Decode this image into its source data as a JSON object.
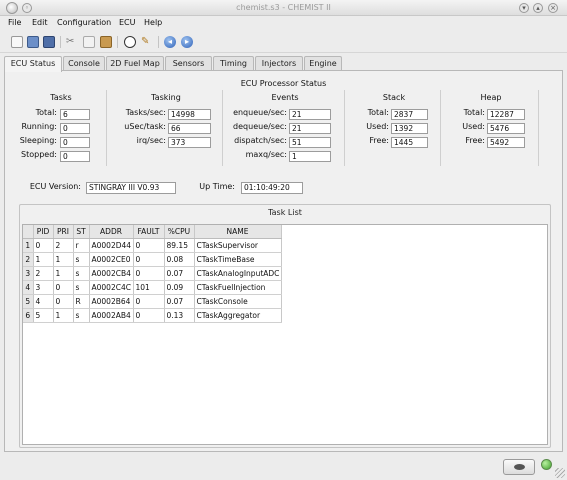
{
  "window": {
    "title": "chemist.s3 - CHEMIST II"
  },
  "menu": [
    "File",
    "Edit",
    "Configuration",
    "ECU",
    "Help"
  ],
  "tabs": [
    "ECU Status",
    "Console",
    "2D Fuel Map",
    "Sensors",
    "Timing",
    "Injectors",
    "Engine"
  ],
  "status": {
    "title": "ECU Processor Status",
    "tasks": {
      "heading": "Tasks",
      "total_label": "Total:",
      "total": "6",
      "running_label": "Running:",
      "running": "0",
      "sleeping_label": "Sleeping:",
      "sleeping": "0",
      "stopped_label": "Stopped:",
      "stopped": "0"
    },
    "tasking": {
      "heading": "Tasking",
      "tps_label": "Tasks/sec:",
      "tps": "14998",
      "ups_label": "uSec/task:",
      "ups": "66",
      "irq_label": "irq/sec:",
      "irq": "373"
    },
    "events": {
      "heading": "Events",
      "enq_label": "enqueue/sec:",
      "enq": "21",
      "deq_label": "dequeue/sec:",
      "deq": "21",
      "dis_label": "dispatch/sec:",
      "dis": "51",
      "maxq_label": "maxq/sec:",
      "maxq": "1"
    },
    "stack": {
      "heading": "Stack",
      "total_label": "Total:",
      "total": "2837",
      "used_label": "Used:",
      "used": "1392",
      "free_label": "Free:",
      "free": "1445"
    },
    "heap": {
      "heading": "Heap",
      "total_label": "Total:",
      "total": "12287",
      "used_label": "Used:",
      "used": "5476",
      "free_label": "Free:",
      "free": "5492"
    },
    "version_label": "ECU Version:",
    "version": "STINGRAY III V0.93",
    "uptime_label": "Up Time:",
    "uptime": "01:10:49:20"
  },
  "tasklist": {
    "title": "Task List",
    "columns": [
      "",
      "PID",
      "PRI",
      "ST",
      "ADDR",
      "FAULT",
      "%CPU",
      "NAME"
    ],
    "rows": [
      [
        "1",
        "0",
        "2",
        "r",
        "A0002D44",
        "0",
        "89.15",
        "CTaskSupervisor"
      ],
      [
        "2",
        "1",
        "1",
        "s",
        "A0002CE0",
        "0",
        "0.08",
        "CTaskTimeBase"
      ],
      [
        "3",
        "2",
        "1",
        "s",
        "A0002CB4",
        "0",
        "0.07",
        "CTaskAnalogInputADC"
      ],
      [
        "4",
        "3",
        "0",
        "s",
        "A0002C4C",
        "101",
        "0.09",
        "CTaskFuelInjection"
      ],
      [
        "5",
        "4",
        "0",
        "R",
        "A0002B64",
        "0",
        "0.07",
        "CTaskConsole"
      ],
      [
        "6",
        "5",
        "1",
        "s",
        "A0002AB4",
        "0",
        "0.13",
        "CTaskAggregator"
      ]
    ]
  },
  "icons": [
    "new-icon",
    "open-icon",
    "save-icon",
    "cut-icon",
    "copy-icon",
    "paste-icon",
    "clock-icon",
    "tools-icon",
    "back-icon",
    "forward-icon"
  ]
}
